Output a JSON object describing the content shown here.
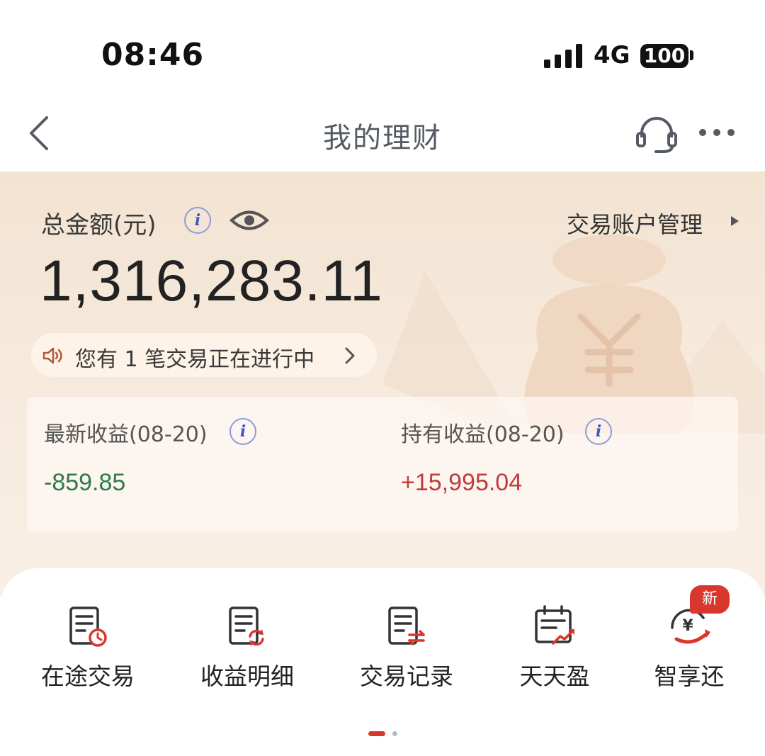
{
  "status_bar": {
    "time": "08:46",
    "network": "4G",
    "battery": "100"
  },
  "nav": {
    "title": "我的理财",
    "icons": [
      "back-icon",
      "headset-icon",
      "more-icon"
    ]
  },
  "summary": {
    "total_label": "总金额(元)",
    "total_amount": "1,316,283.11",
    "account_manage_label": "交易账户管理",
    "notice_text": "您有 1 笔交易正在进行中",
    "icons": [
      "info-icon",
      "eye-icon",
      "speaker-icon",
      "chevron-right-icon"
    ]
  },
  "earnings": {
    "latest_label": "最新收益(08-20)",
    "latest_value": "-859.85",
    "holding_label": "持有收益(08-20)",
    "holding_value": "+15,995.04",
    "latest_color": "#2d7a4a",
    "holding_color": "#c23a3a"
  },
  "quick_actions": [
    {
      "label": "在途交易",
      "icon": "in-transit-trade-icon"
    },
    {
      "label": "收益明细",
      "icon": "earnings-detail-icon"
    },
    {
      "label": "交易记录",
      "icon": "trade-record-icon"
    },
    {
      "label": "天天盈",
      "icon": "daily-profit-icon"
    },
    {
      "label": "智享还",
      "icon": "smart-repay-icon",
      "badge": "新"
    }
  ],
  "colors": {
    "accent": "#d9372e",
    "hero_background": "#f3e3d2",
    "info_icon": "#3f55c4"
  }
}
